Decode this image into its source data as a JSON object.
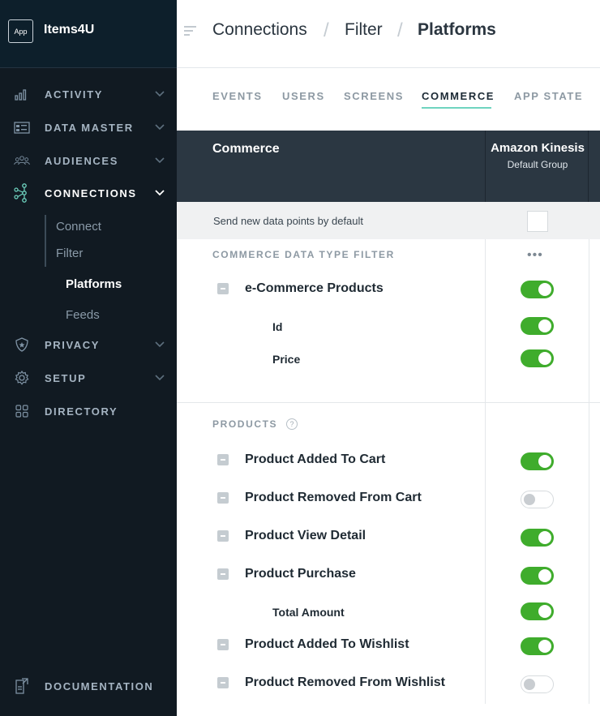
{
  "app": {
    "badge": "App",
    "name": "Items4U"
  },
  "sidebar": {
    "items": [
      {
        "label": "ACTIVITY",
        "icon": "bar-chart-icon"
      },
      {
        "label": "DATA MASTER",
        "icon": "table-icon"
      },
      {
        "label": "AUDIENCES",
        "icon": "people-icon"
      },
      {
        "label": "CONNECTIONS",
        "icon": "connections-icon",
        "active": true
      },
      {
        "label": "PRIVACY",
        "icon": "shield-icon"
      },
      {
        "label": "SETUP",
        "icon": "gear-icon"
      },
      {
        "label": "DIRECTORY",
        "icon": "grid-icon"
      }
    ],
    "sub_items": [
      {
        "label": "Connect"
      },
      {
        "label": "Filter"
      },
      {
        "label": "Platforms",
        "active": true
      },
      {
        "label": "Feeds"
      }
    ],
    "documentation": "DOCUMENTATION"
  },
  "breadcrumb": {
    "c1": "Connections",
    "c2": "Filter",
    "c3": "Platforms",
    "sep": "/"
  },
  "tabs": [
    {
      "label": "EVENTS"
    },
    {
      "label": "USERS"
    },
    {
      "label": "SCREENS"
    },
    {
      "label": "COMMERCE",
      "active": true
    },
    {
      "label": "APP STATE"
    }
  ],
  "table": {
    "title": "Commerce",
    "column": {
      "name": "Amazon Kinesis",
      "sub": "Default Group"
    },
    "default_row": {
      "label": "Send new data points by default",
      "checked": false
    },
    "sections": [
      {
        "label": "COMMERCE DATA TYPE FILTER",
        "more": "•••",
        "rows": [
          {
            "label": "e-Commerce Products",
            "enabled": true
          },
          {
            "label": "Id",
            "enabled": true,
            "sub": true
          },
          {
            "label": "Price",
            "enabled": true,
            "sub": true
          }
        ]
      },
      {
        "label": "PRODUCTS",
        "help": "?",
        "rows": [
          {
            "label": "Product Added To Cart",
            "enabled": true
          },
          {
            "label": "Product Removed From Cart",
            "enabled": false
          },
          {
            "label": "Product View Detail",
            "enabled": true
          },
          {
            "label": "Product Purchase",
            "enabled": true
          },
          {
            "label": "Total Amount",
            "enabled": true,
            "sub": true
          },
          {
            "label": "Product Added To Wishlist",
            "enabled": true
          },
          {
            "label": "Product Removed From Wishlist",
            "enabled": false
          }
        ]
      }
    ]
  },
  "colors": {
    "sidebar_bg": "#111a22",
    "accent": "#6fd4c0",
    "toggle_on": "#3fac2c",
    "table_header": "#2b3742"
  }
}
